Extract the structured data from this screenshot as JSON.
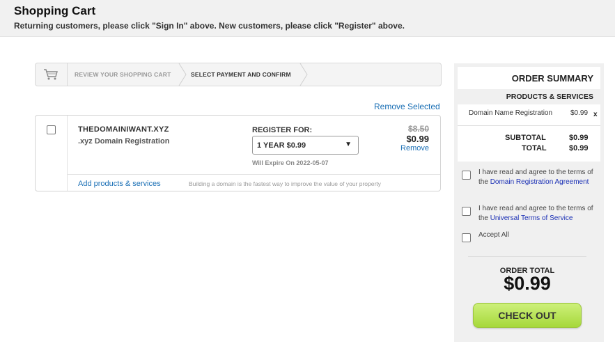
{
  "header": {
    "title": "Shopping Cart",
    "subtitle": "Returning customers, please click \"Sign In\" above. New customers, please click \"Register\" above."
  },
  "steps": [
    {
      "label": "REVIEW YOUR SHOPPING CART",
      "active": false
    },
    {
      "label": "SELECT PAYMENT AND CONFIRM",
      "active": true
    }
  ],
  "cart": {
    "remove_selected": "Remove Selected",
    "item": {
      "domain": "THEDOMAINIWANT.XYZ",
      "type": ".xyz Domain Registration",
      "register_for_label": "REGISTER FOR:",
      "term_selected": "1 YEAR $0.99",
      "expires": "Will Expire On 2022-05-07",
      "old_price": "$8.50",
      "price": "$0.99",
      "remove": "Remove"
    },
    "add_link": "Add products & services",
    "tip": "Building a domain is the fastest way to improve the value of your property"
  },
  "summary": {
    "title": "ORDER SUMMARY",
    "section": "PRODUCTS & SERVICES",
    "line_name": "Domain Name Registration",
    "line_price": "$0.99",
    "line_remove": "x",
    "subtotal_label": "SUBTOTAL",
    "subtotal": "$0.99",
    "total_label": "TOTAL",
    "total": "$0.99",
    "terms1_prefix": "I have read and agree to the terms of the",
    "terms1_link": "Domain Registration Agreement",
    "terms2_prefix": "I have read and agree to the terms of the",
    "terms2_link": "Universal Terms of Service",
    "accept_all": "Accept All",
    "order_total_label": "ORDER TOTAL",
    "order_total": "$0.99",
    "checkout": "CHECK OUT"
  }
}
